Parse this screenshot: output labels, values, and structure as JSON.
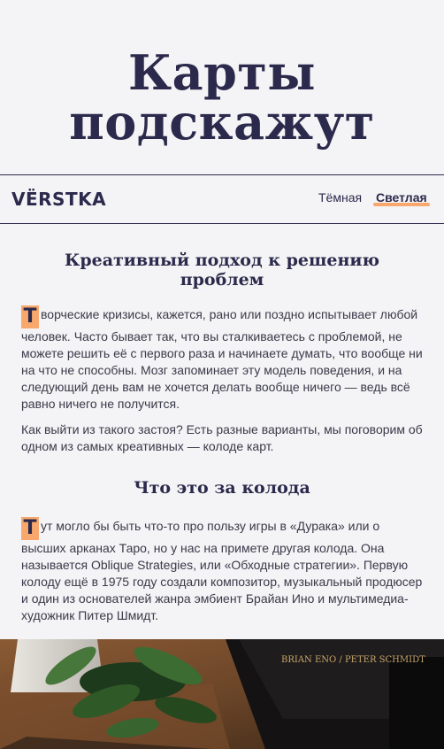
{
  "hero": {
    "title_line1": "Карты",
    "title_line2": "подскажут"
  },
  "nav": {
    "logo": "VЁRSTKA",
    "theme_dark": "Тёмная",
    "theme_light": "Светлая"
  },
  "section1": {
    "heading": "Креативный подход к решению проблем",
    "p1_cap": "Т",
    "p1_rest": "ворческие кризисы, кажется, рано или поздно испытывает любой человек. Часто бывает так, что вы сталкиваетесь с проблемой, не можете решить её с первого раза и начинаете думать, что вообще ни на что не способны. Мозг запоминает эту модель поведения, и на следующий день вам не хочется делать вообще ничего — ведь всё равно ничего не получится.",
    "p2": "Как выйти из такого застоя? Есть разные варианты, мы поговорим об одном из самых креативных — колоде карт."
  },
  "section2": {
    "heading": "Что это за колода",
    "p1_cap": "Т",
    "p1_rest": "ут могло бы быть что-то про пользу игры в «Дурака» или о высших арканах Таро, но у нас на примете другая колода. Она называется Oblique Strategies, или «Обходные стратегии». Первую колоду ещё в 1975 году создали композитор, музыкальный продюсер и один из основателей жанра эмбиент Брайан Ино и мультимедиа-художник Питер Шмидт."
  },
  "photo": {
    "box_label": "BRIAN ENO / PETER SCHMIDT"
  },
  "colors": {
    "accent": "#f8a86c",
    "text": "#2b2a4c",
    "background": "#f4f3f5"
  }
}
